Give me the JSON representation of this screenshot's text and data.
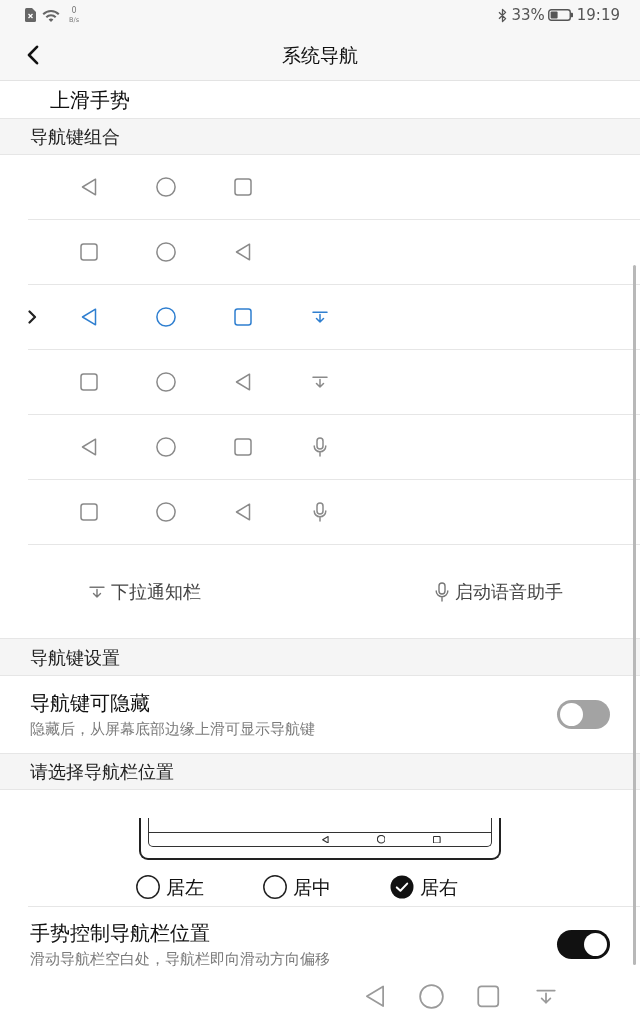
{
  "status_bar": {
    "network_speed": "0",
    "network_speed_unit": "B/s",
    "battery": "33%",
    "time": "19:19"
  },
  "header": {
    "title": "系统导航"
  },
  "gesture_row": {
    "label": "上滑手势"
  },
  "combinations": {
    "title": "导航键组合",
    "options": [
      {
        "selected": false,
        "keys": [
          {
            "kind": "back"
          },
          {
            "kind": "home"
          },
          {
            "kind": "recents"
          }
        ]
      },
      {
        "selected": false,
        "keys": [
          {
            "kind": "recents"
          },
          {
            "kind": "home"
          },
          {
            "kind": "back"
          }
        ]
      },
      {
        "selected": true,
        "keys": [
          {
            "kind": "back"
          },
          {
            "kind": "home"
          },
          {
            "kind": "recents"
          },
          {
            "kind": "pulldown"
          }
        ]
      },
      {
        "selected": false,
        "keys": [
          {
            "kind": "recents"
          },
          {
            "kind": "home"
          },
          {
            "kind": "back"
          },
          {
            "kind": "pulldown"
          }
        ]
      },
      {
        "selected": false,
        "keys": [
          {
            "kind": "back"
          },
          {
            "kind": "home"
          },
          {
            "kind": "recents"
          },
          {
            "kind": "voice"
          }
        ]
      },
      {
        "selected": false,
        "keys": [
          {
            "kind": "recents"
          },
          {
            "kind": "home"
          },
          {
            "kind": "back"
          },
          {
            "kind": "voice"
          }
        ]
      }
    ],
    "legend": [
      {
        "kind": "pulldown",
        "label": "下拉通知栏"
      },
      {
        "kind": "voice",
        "label": "启动语音助手"
      }
    ]
  },
  "key_settings": {
    "title": "导航键设置",
    "options": [
      {
        "title": "导航键可隐藏",
        "description": "隐藏后，从屏幕底部边缘上滑可显示导航键",
        "on": false
      }
    ]
  },
  "position": {
    "title": "请选择导航栏位置",
    "choices": [
      {
        "label": "居左",
        "selected": false
      },
      {
        "label": "居中",
        "selected": false
      },
      {
        "label": "居右",
        "selected": true
      }
    ],
    "options": [
      {
        "title": "手势控制导航栏位置",
        "description": "滑动导航栏空白处，导航栏即向滑动方向偏移",
        "on": true
      }
    ]
  },
  "nav_bar": {
    "keys": [
      {
        "kind": "back"
      },
      {
        "kind": "home"
      },
      {
        "kind": "recents"
      },
      {
        "kind": "pulldown"
      }
    ]
  }
}
